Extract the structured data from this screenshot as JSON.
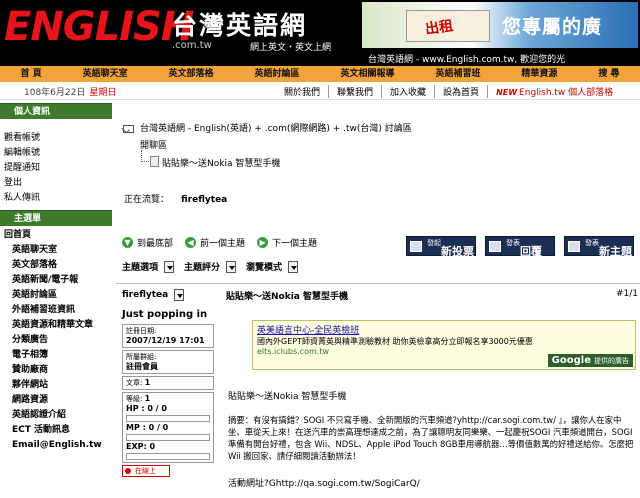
{
  "header": {
    "logo_text": "ENGLISH",
    "logo_sub": ".com.tw",
    "site_title": "台灣英語網",
    "tagline": "網上英文・英文上網",
    "banner_left_tag": "出租",
    "banner_right_text": "您專屬的廣",
    "welcome": "台灣英語網 - www.English.com.tw, 歡迎您的光"
  },
  "nav": [
    "首 頁",
    "英語聊天室",
    "英文部落格",
    "英語討論區",
    "英文相關報導",
    "英語補習班",
    "精華資源",
    "搜 尋"
  ],
  "datebar": {
    "date": "108年6月22日",
    "weekday": "星期日",
    "links": [
      "關於我們",
      "聯繫我們",
      "加入收藏",
      "設為首頁"
    ],
    "new_badge": "NEW",
    "personal": "English.tw 個人部落格"
  },
  "sidebar": {
    "section1": "個人資訊",
    "personal_links": [
      "觀看帳號",
      "編輯帳號",
      "提醒通知",
      "登出",
      "私人傳訊"
    ],
    "section2": "主選單",
    "home": "回首頁",
    "menu_links": [
      "英語聊天室",
      "英文部落格",
      "英語新聞/電子報",
      "英語討論區",
      "外語補習班資訊",
      "英語資源和精華文章",
      "分類廣告",
      "電子相簿",
      "贊助廠商",
      "夥伴網站",
      "網路資源",
      "英語認證介紹",
      "ECT 活動訊息",
      "Email@English.tw"
    ]
  },
  "main": {
    "breadcrumb": "台灣英語網 - English(英語) + .com(網際網路) + .tw(台灣) 討論區",
    "breadcrumb2": "開聊區",
    "thread": "貼貼樂～送Nokia 智慧型手機",
    "viewing_label": "正在流覽：",
    "viewer": "fireflytea",
    "nav_links": [
      "到最底部",
      "前一個主題",
      "下一個主題"
    ],
    "buttons": [
      {
        "small": "發起",
        "big": "新投票"
      },
      {
        "small": "發表",
        "big": "回覆"
      },
      {
        "small": "發表",
        "big": "新主題"
      }
    ],
    "selectors": [
      "主題選項",
      "主題評分",
      "瀏覽模式"
    ]
  },
  "post": {
    "author": "fireflytea",
    "title": "貼貼樂～送Nokia 智慧型手機",
    "num": "#1/1",
    "user_title": "Just popping in",
    "reg_label": "註冊日期:",
    "reg_date": "2007/12/19 17:01",
    "group_label": "所屬群組:",
    "group": "註冊會員",
    "posts_label": "文章:",
    "posts": "1",
    "level_label": "等級:",
    "level": "1",
    "hp": "HP : 0 / 0",
    "mp": "MP : 0 / 0",
    "exp": "EXP: 0",
    "offline": "在線上",
    "ad_title": "英美語言中心-全民英檢班",
    "ad_body": "國內外GEPT師資菁英與精準測驗教材 助你英檢拿高分立即報名享3000元優惠",
    "ad_url": "elts.iclubs.com.tw",
    "google": "Google",
    "google_sub": "提供的廣告",
    "body_title": "貼貼樂～送Nokia 智慧型手機",
    "body": "摘要：有沒有搞錯？SOGI 不只寫手機、全新開版的汽車頻道?yhttp://car.sogi.com.tw/ 』，讓你人在家中坐、車從天上來！在送汽車的崇高理想達成之前，為了讓聰明友同樂樂、一起慶祝SOGI 汽車頻道開台，SOGI 準備有開台好禮，包含 Wii、NDSL、Apple iPod Touch 8GB車用導航器…等價值數萬的好禮送給你。怎麼把 Wii 搬回家、請仔細閱讀活動辦法！",
    "body_link": "活動網址?Ghttp://qa.sogi.com.tw/SogiCarQ/"
  },
  "colors": {
    "nav": "#f2a33a",
    "sidebar_head": "#3e7a2c",
    "button": "#1b2f55",
    "logo": "#e8141c"
  }
}
